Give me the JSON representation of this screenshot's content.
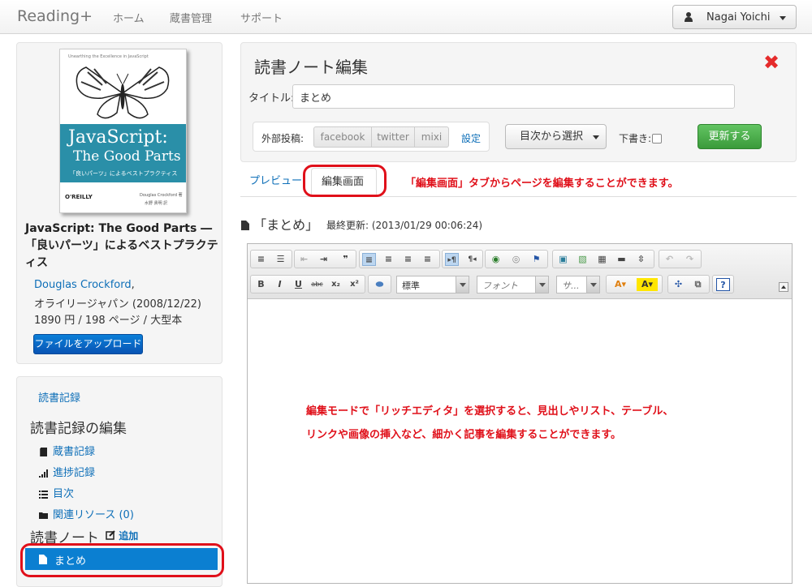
{
  "nav": {
    "brand": "Reading+",
    "links": [
      "ホーム",
      "蔵書管理",
      "サポート"
    ],
    "user": "Nagai Yoichi"
  },
  "book": {
    "cover": {
      "small_text": "Unearthing the Excellence in JavaScript",
      "title_line1": "JavaScript:",
      "title_line2": "The Good Parts",
      "subtitle": "「良いパーツ」によるベストプラクティス",
      "publisher": "O'REILLY",
      "author_small": "Douglas Crockford 著",
      "translator_small": "水野 貴明 訳"
    },
    "title": "JavaScript: The Good Parts ―「良いパーツ」によるベストプラクティス",
    "author": "Douglas Crockford",
    "author_sep": ",",
    "publisher_line": "オライリージャパン (2008/12/22)",
    "price_line": "1890 円 / 198 ページ / 大型本",
    "upload_label": "ファイルをアップロード"
  },
  "sidebar": {
    "record_link": "読書記録",
    "edit_heading": "読書記録の編集",
    "items": [
      {
        "label": "蔵書記録",
        "icon": "book-icon"
      },
      {
        "label": "進捗記録",
        "icon": "signal-icon"
      },
      {
        "label": "目次",
        "icon": "list-icon"
      },
      {
        "label": "関連リソース (0)",
        "icon": "folder-icon"
      }
    ],
    "notes_heading": "読書ノート",
    "add_label": "追加",
    "active_note": "まとめ"
  },
  "editor_panel": {
    "title": "読書ノート編集",
    "close_symbol": "✖",
    "title_label": "タイトル:",
    "title_value": "まとめ",
    "share_label": "外部投稿:",
    "share_buttons": [
      "facebook",
      "twitter",
      "mixi"
    ],
    "share_settings": "設定",
    "toc_select": "目次から選択",
    "draft_label": "下書き:",
    "draft_checked": false,
    "update_label": "更新する"
  },
  "tabs": {
    "preview": "プレビュー",
    "edit": "編集画面",
    "annotation": "「編集画面」タブからページを編集することができます。"
  },
  "note": {
    "title": "「まとめ」",
    "updated_label": "最終更新: (2013/01/29 00:06:24)"
  },
  "rich_editor": {
    "format_value": "標準",
    "font_placeholder": "フォント",
    "size_placeholder": "サ...",
    "annotation_line1": "編集モードで「リッチエディタ」を選択すると、見出しやリスト、テーブル、",
    "annotation_line2": "リンクや画像の挿入など、細かく記事を編集することができます。"
  },
  "colors": {
    "link": "#0e6fb8",
    "annotation_red": "#e0101a",
    "update_green": "#4cae4c",
    "active_blue": "#0b7fd1"
  }
}
